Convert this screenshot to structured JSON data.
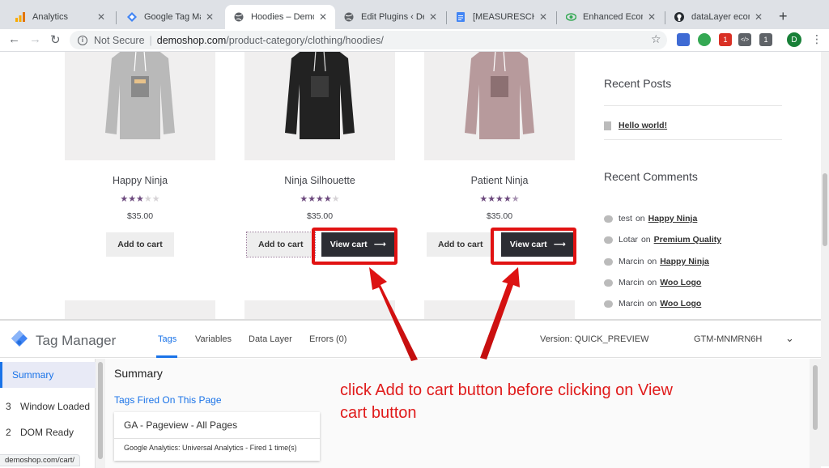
{
  "browser": {
    "tabs": [
      {
        "title": "Analytics",
        "active": false,
        "icon": "analytics-icon"
      },
      {
        "title": "Google Tag Manag",
        "active": false,
        "icon": "gtm-icon"
      },
      {
        "title": "Hoodies – Demosh",
        "active": true,
        "icon": "globe-icon"
      },
      {
        "title": "Edit Plugins ‹ Dem",
        "active": false,
        "icon": "globe-icon"
      },
      {
        "title": "[MEASURESCHOO",
        "active": false,
        "icon": "docs-icon"
      },
      {
        "title": "Enhanced Ecomm",
        "active": false,
        "icon": "eye-icon"
      },
      {
        "title": "dataLayer ecomm",
        "active": false,
        "icon": "github-icon"
      }
    ],
    "new_tab": "+",
    "address": {
      "security": "Not Secure",
      "host": "demoshop.com",
      "path": "/product-category/clothing/hoodies/"
    },
    "profile_initial": "D",
    "extensions": [
      {
        "label": "",
        "color": "#3f6bd4"
      },
      {
        "label": "",
        "color": "#34a853"
      },
      {
        "label": "1",
        "color": "#d93025"
      },
      {
        "label": "</>",
        "color": "#5f6368"
      },
      {
        "label": "1",
        "color": "#5f6368"
      }
    ]
  },
  "products": [
    {
      "name": "Happy Ninja",
      "rating": 3,
      "price": "$35.00",
      "add_to_cart": "Add to cart",
      "view_cart": null,
      "hoodie_color": "#b9b9b9",
      "hoodie_shade": "#a2a2a2"
    },
    {
      "name": "Ninja Silhouette",
      "rating": 4,
      "price": "$35.00",
      "add_to_cart": "Add to cart",
      "view_cart": "View cart",
      "hoodie_color": "#222222",
      "hoodie_shade": "#111111"
    },
    {
      "name": "Patient Ninja",
      "rating": 4.5,
      "price": "$35.00",
      "add_to_cart": "Add to cart",
      "view_cart": "View cart",
      "hoodie_color": "#b79a9c",
      "hoodie_shade": "#9d8082"
    }
  ],
  "sidebar": {
    "recent_posts_title": "Recent Posts",
    "posts": [
      "Hello world!"
    ],
    "recent_comments_title": "Recent Comments",
    "comments": [
      {
        "author": "test",
        "on": "on",
        "post": "Happy Ninja"
      },
      {
        "author": "Lotar",
        "on": "on",
        "post": "Premium Quality"
      },
      {
        "author": "Marcin",
        "on": "on",
        "post": "Happy Ninja"
      },
      {
        "author": "Marcin",
        "on": "on",
        "post": "Woo Logo"
      },
      {
        "author": "Marcin",
        "on": "on",
        "post": "Woo Logo"
      }
    ]
  },
  "tag_manager": {
    "brand": "Tag Manager",
    "tabs": [
      "Tags",
      "Variables",
      "Data Layer",
      "Errors (0)"
    ],
    "active_tab": "Tags",
    "version": "Version: QUICK_PREVIEW",
    "container_id": "GTM-MNMRN6H",
    "summary_label": "Summary",
    "events": [
      {
        "n": "3",
        "label": "Window Loaded"
      },
      {
        "n": "2",
        "label": "DOM Ready"
      }
    ],
    "main_title": "Summary",
    "fired_heading": "Tags Fired On This Page",
    "tag": {
      "name": "GA - Pageview - All Pages",
      "detail": "Google Analytics: Universal Analytics - Fired 1 time(s)"
    }
  },
  "annotation": {
    "text": "click Add to cart button before clicking on View cart button",
    "color": "#e01b1b"
  },
  "status_url": "demoshop.com/cart/",
  "colors": {
    "rating": "#6d4a7e",
    "gtm_blue": "#1a73e8",
    "callout_red": "#e11212"
  }
}
